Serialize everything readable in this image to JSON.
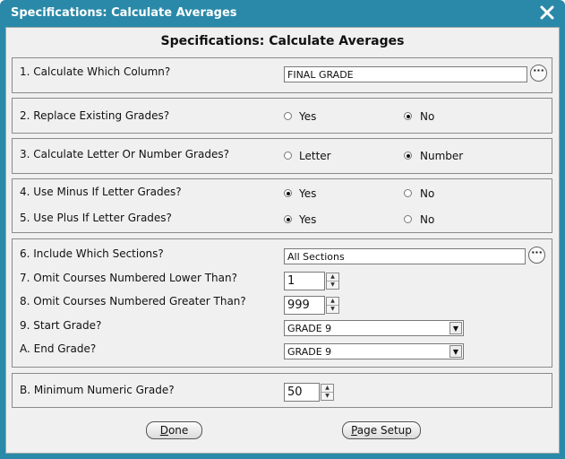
{
  "window": {
    "title": "Specifications: Calculate Averages"
  },
  "heading": "Specifications: Calculate Averages",
  "q1": {
    "label": "1. Calculate Which Column?",
    "value": "FINAL GRADE"
  },
  "q2": {
    "label": "2. Replace Existing Grades?",
    "opt_yes": "Yes",
    "opt_no": "No",
    "selected": "No"
  },
  "q3": {
    "label": "3. Calculate Letter Or Number Grades?",
    "opt_letter": "Letter",
    "opt_number": "Number",
    "selected": "Number"
  },
  "q4": {
    "label": "4. Use Minus If Letter Grades?",
    "opt_yes": "Yes",
    "opt_no": "No",
    "selected": "Yes"
  },
  "q5": {
    "label": "5. Use Plus If Letter Grades?",
    "opt_yes": "Yes",
    "opt_no": "No",
    "selected": "Yes"
  },
  "q6": {
    "label": "6. Include Which Sections?",
    "value": "All Sections"
  },
  "q7": {
    "label": "7. Omit Courses Numbered Lower Than?",
    "value": "1"
  },
  "q8": {
    "label": "8. Omit Courses Numbered Greater Than?",
    "value": "999"
  },
  "q9": {
    "label": "9. Start Grade?",
    "value": "GRADE 9"
  },
  "qa": {
    "label": "A. End Grade?",
    "value": "GRADE 9"
  },
  "qb": {
    "label": "B. Minimum Numeric Grade?",
    "value": "50"
  },
  "buttons": {
    "done_first": "D",
    "done_rest": "one",
    "page_first": "P",
    "page_rest": "age Setup"
  },
  "colors": {
    "titlebar": "#2a89a8",
    "background": "#f0f0f0"
  }
}
